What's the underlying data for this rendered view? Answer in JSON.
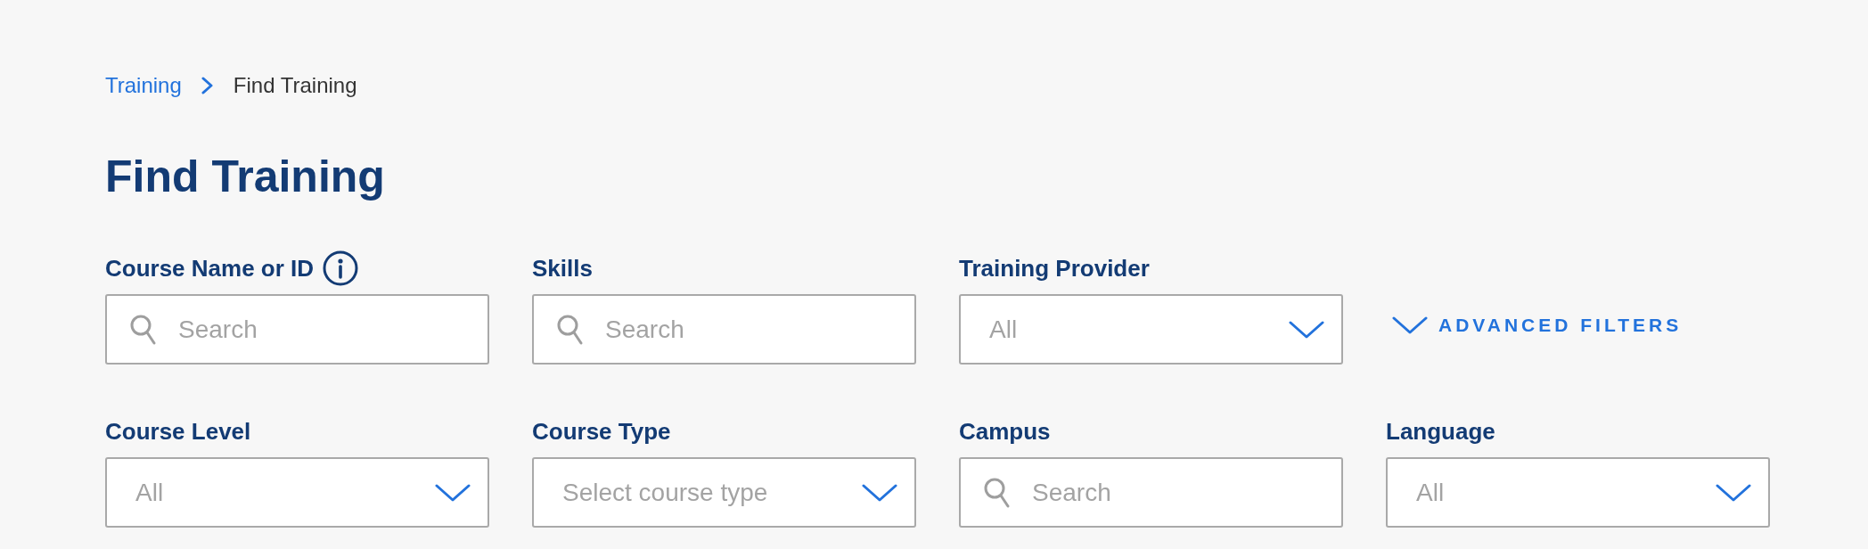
{
  "breadcrumb": [
    {
      "label": "Training",
      "kind": "link"
    },
    {
      "label": "Find Training",
      "kind": "current"
    }
  ],
  "page_title": "Find Training",
  "filters": [
    {
      "label": "Course Name or ID",
      "info": true,
      "kind": "search",
      "placeholder": "Search"
    },
    {
      "label": "Skills",
      "kind": "search",
      "placeholder": "Search"
    },
    {
      "label": "Training Provider",
      "kind": "select",
      "placeholder": "All"
    },
    {
      "label": "Course Level",
      "kind": "select",
      "placeholder": "All"
    },
    {
      "label": "Course Type",
      "kind": "select",
      "placeholder": "Select course type"
    },
    {
      "label": "Campus",
      "kind": "search",
      "placeholder": "Search"
    },
    {
      "label": "Language",
      "kind": "select",
      "placeholder": "All"
    }
  ],
  "advanced_filters": {
    "label": "ADVANCED FILTERS",
    "expanded": false
  }
}
